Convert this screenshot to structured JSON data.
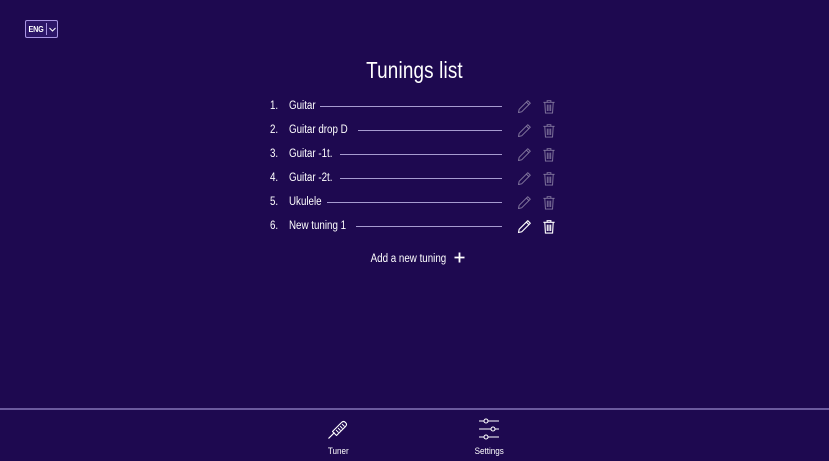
{
  "language": {
    "label": "ENG",
    "chevron_icon": "chevron-down-icon"
  },
  "page": {
    "title": "Tunings list"
  },
  "tunings": [
    {
      "number": "1.",
      "name": "Guitar",
      "state": "faded"
    },
    {
      "number": "2.",
      "name": "Guitar drop D",
      "state": "faded"
    },
    {
      "number": "3.",
      "name": "Guitar -1t.",
      "state": "faded"
    },
    {
      "number": "4.",
      "name": "Guitar -2t.",
      "state": "faded"
    },
    {
      "number": "5.",
      "name": "Ukulele",
      "state": "faded"
    },
    {
      "number": "6.",
      "name": "New tuning 1",
      "state": "active"
    }
  ],
  "actions": {
    "add_label": "Add a new tuning",
    "add_icon": "plus-icon",
    "edit_icon": "pencil-icon",
    "delete_icon": "trash-icon"
  },
  "nav": {
    "tuner_label": "Tuner",
    "tuner_icon": "tuning-fork-icon",
    "settings_label": "Settings",
    "settings_icon": "sliders-icon"
  },
  "colors": {
    "background": "#1e0950",
    "text": "#ffffff",
    "line": "#a69bd0",
    "border": "#6b5a9e"
  }
}
